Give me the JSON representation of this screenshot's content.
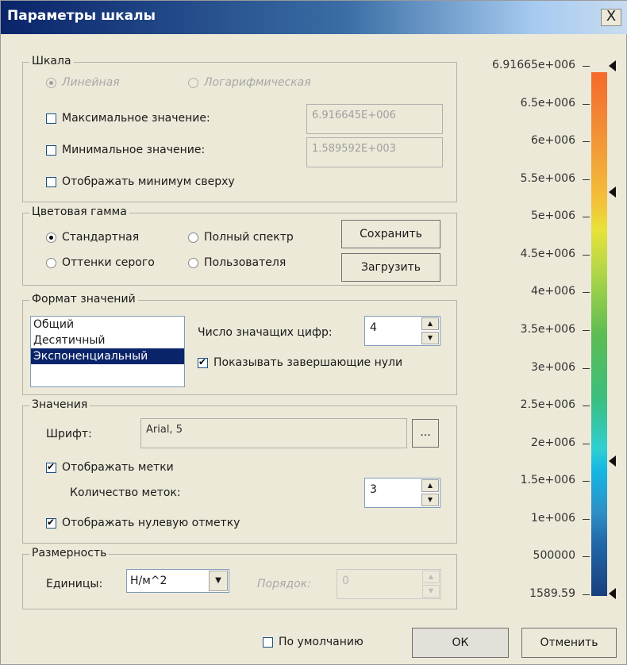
{
  "window": {
    "title": "Параметры шкалы",
    "close_label": "X"
  },
  "scale_group": {
    "title": "Шкала",
    "linear_label": "Линейная",
    "log_label": "Логарифмическая",
    "max_label": "Максимальное значение:",
    "max_value": "6.916645E+006",
    "min_label": "Минимальное значение:",
    "min_value": "1.589592E+003",
    "show_min_top_label": "Отображать минимум сверху"
  },
  "color_group": {
    "title": "Цветовая гамма",
    "standard_label": "Стандартная",
    "full_spectrum_label": "Полный спектр",
    "grayscale_label": "Оттенки серого",
    "user_label": "Пользователя",
    "save_label": "Сохранить",
    "load_label": "Загрузить"
  },
  "format_group": {
    "title": "Формат значений",
    "formats": [
      "Общий",
      "Десятичный",
      "Экспоненциальный"
    ],
    "selected_format": "Экспоненциальный",
    "digits_label": "Число значащих цифр:",
    "digits_value": "4",
    "trailing_zeros_label": "Показывать завершающие нули"
  },
  "values_group": {
    "title": "Значения",
    "font_label": "Шрифт:",
    "font_value": "Arial, 5",
    "font_button_label": "...",
    "show_labels_label": "Отображать метки",
    "label_count_label": "Количество меток:",
    "label_count_value": "3",
    "show_zero_label": "Отображать нулевую отметку"
  },
  "dimension_group": {
    "title": "Размерность",
    "units_label": "Единицы:",
    "units_value": "Н/м^2",
    "order_label": "Порядок:",
    "order_value": "0"
  },
  "footer": {
    "default_label": "По умолчанию",
    "ok_label": "ОК",
    "cancel_label": "Отменить"
  },
  "colorbar": {
    "ticks": [
      "6.91665e+006",
      "6.5e+006",
      "6e+006",
      "5.5e+006",
      "5e+006",
      "4.5e+006",
      "4e+006",
      "3.5e+006",
      "3e+006",
      "2.5e+006",
      "2e+006",
      "1.5e+006",
      "1e+006",
      "500000",
      "1589.59"
    ],
    "colors": {
      "top": "#f56a2c",
      "middle": "#5dbc52",
      "bottom": "#1a3f7d"
    }
  },
  "icons": {
    "close": "close-icon",
    "spin_up": "spin-up-icon",
    "spin_down": "spin-down-icon",
    "dropdown": "chevron-down-icon",
    "marker": "triangle-left-icon"
  }
}
